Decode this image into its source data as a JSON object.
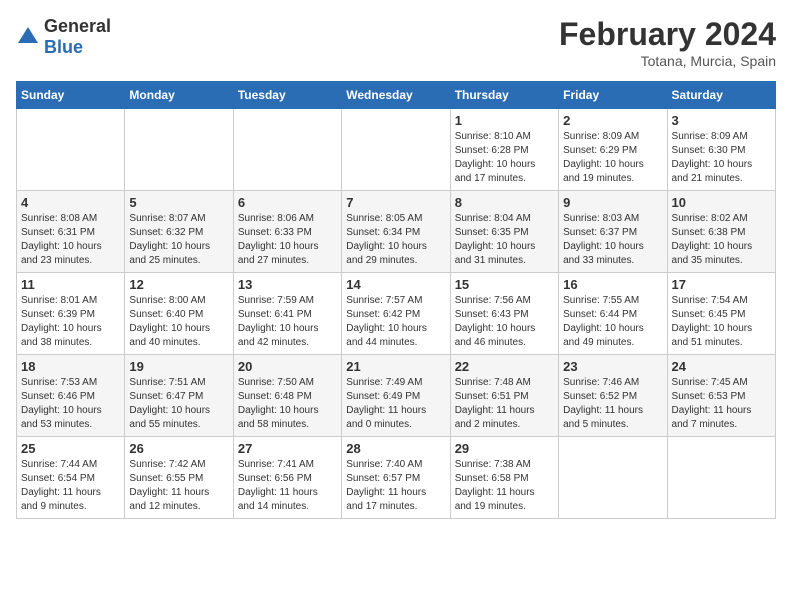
{
  "logo": {
    "general": "General",
    "blue": "Blue"
  },
  "title": "February 2024",
  "location": "Totana, Murcia, Spain",
  "weekdays": [
    "Sunday",
    "Monday",
    "Tuesday",
    "Wednesday",
    "Thursday",
    "Friday",
    "Saturday"
  ],
  "weeks": [
    [
      {
        "day": "",
        "info": ""
      },
      {
        "day": "",
        "info": ""
      },
      {
        "day": "",
        "info": ""
      },
      {
        "day": "",
        "info": ""
      },
      {
        "day": "1",
        "info": "Sunrise: 8:10 AM\nSunset: 6:28 PM\nDaylight: 10 hours\nand 17 minutes."
      },
      {
        "day": "2",
        "info": "Sunrise: 8:09 AM\nSunset: 6:29 PM\nDaylight: 10 hours\nand 19 minutes."
      },
      {
        "day": "3",
        "info": "Sunrise: 8:09 AM\nSunset: 6:30 PM\nDaylight: 10 hours\nand 21 minutes."
      }
    ],
    [
      {
        "day": "4",
        "info": "Sunrise: 8:08 AM\nSunset: 6:31 PM\nDaylight: 10 hours\nand 23 minutes."
      },
      {
        "day": "5",
        "info": "Sunrise: 8:07 AM\nSunset: 6:32 PM\nDaylight: 10 hours\nand 25 minutes."
      },
      {
        "day": "6",
        "info": "Sunrise: 8:06 AM\nSunset: 6:33 PM\nDaylight: 10 hours\nand 27 minutes."
      },
      {
        "day": "7",
        "info": "Sunrise: 8:05 AM\nSunset: 6:34 PM\nDaylight: 10 hours\nand 29 minutes."
      },
      {
        "day": "8",
        "info": "Sunrise: 8:04 AM\nSunset: 6:35 PM\nDaylight: 10 hours\nand 31 minutes."
      },
      {
        "day": "9",
        "info": "Sunrise: 8:03 AM\nSunset: 6:37 PM\nDaylight: 10 hours\nand 33 minutes."
      },
      {
        "day": "10",
        "info": "Sunrise: 8:02 AM\nSunset: 6:38 PM\nDaylight: 10 hours\nand 35 minutes."
      }
    ],
    [
      {
        "day": "11",
        "info": "Sunrise: 8:01 AM\nSunset: 6:39 PM\nDaylight: 10 hours\nand 38 minutes."
      },
      {
        "day": "12",
        "info": "Sunrise: 8:00 AM\nSunset: 6:40 PM\nDaylight: 10 hours\nand 40 minutes."
      },
      {
        "day": "13",
        "info": "Sunrise: 7:59 AM\nSunset: 6:41 PM\nDaylight: 10 hours\nand 42 minutes."
      },
      {
        "day": "14",
        "info": "Sunrise: 7:57 AM\nSunset: 6:42 PM\nDaylight: 10 hours\nand 44 minutes."
      },
      {
        "day": "15",
        "info": "Sunrise: 7:56 AM\nSunset: 6:43 PM\nDaylight: 10 hours\nand 46 minutes."
      },
      {
        "day": "16",
        "info": "Sunrise: 7:55 AM\nSunset: 6:44 PM\nDaylight: 10 hours\nand 49 minutes."
      },
      {
        "day": "17",
        "info": "Sunrise: 7:54 AM\nSunset: 6:45 PM\nDaylight: 10 hours\nand 51 minutes."
      }
    ],
    [
      {
        "day": "18",
        "info": "Sunrise: 7:53 AM\nSunset: 6:46 PM\nDaylight: 10 hours\nand 53 minutes."
      },
      {
        "day": "19",
        "info": "Sunrise: 7:51 AM\nSunset: 6:47 PM\nDaylight: 10 hours\nand 55 minutes."
      },
      {
        "day": "20",
        "info": "Sunrise: 7:50 AM\nSunset: 6:48 PM\nDaylight: 10 hours\nand 58 minutes."
      },
      {
        "day": "21",
        "info": "Sunrise: 7:49 AM\nSunset: 6:49 PM\nDaylight: 11 hours\nand 0 minutes."
      },
      {
        "day": "22",
        "info": "Sunrise: 7:48 AM\nSunset: 6:51 PM\nDaylight: 11 hours\nand 2 minutes."
      },
      {
        "day": "23",
        "info": "Sunrise: 7:46 AM\nSunset: 6:52 PM\nDaylight: 11 hours\nand 5 minutes."
      },
      {
        "day": "24",
        "info": "Sunrise: 7:45 AM\nSunset: 6:53 PM\nDaylight: 11 hours\nand 7 minutes."
      }
    ],
    [
      {
        "day": "25",
        "info": "Sunrise: 7:44 AM\nSunset: 6:54 PM\nDaylight: 11 hours\nand 9 minutes."
      },
      {
        "day": "26",
        "info": "Sunrise: 7:42 AM\nSunset: 6:55 PM\nDaylight: 11 hours\nand 12 minutes."
      },
      {
        "day": "27",
        "info": "Sunrise: 7:41 AM\nSunset: 6:56 PM\nDaylight: 11 hours\nand 14 minutes."
      },
      {
        "day": "28",
        "info": "Sunrise: 7:40 AM\nSunset: 6:57 PM\nDaylight: 11 hours\nand 17 minutes."
      },
      {
        "day": "29",
        "info": "Sunrise: 7:38 AM\nSunset: 6:58 PM\nDaylight: 11 hours\nand 19 minutes."
      },
      {
        "day": "",
        "info": ""
      },
      {
        "day": "",
        "info": ""
      }
    ]
  ]
}
